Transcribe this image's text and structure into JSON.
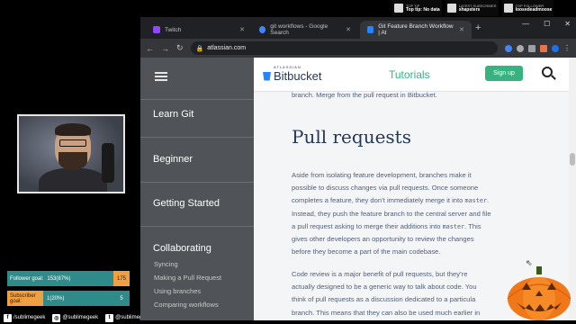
{
  "overlay": {
    "items": [
      {
        "title": "Top tip",
        "value": "Top tip: No data",
        "icon": "trophy-icon"
      },
      {
        "title": "Latest subscriber",
        "value": "shapsters",
        "icon": "star-icon"
      },
      {
        "title": "Top follower",
        "value": "loosedeadmoose",
        "icon": "heart-icon"
      }
    ]
  },
  "goals": {
    "follower": {
      "label": "Follower goal:",
      "value": "153(87%)",
      "target": "175"
    },
    "subscriber": {
      "label": "Subscriber goal:",
      "value": "1(20%)",
      "target": "5"
    }
  },
  "socials": [
    {
      "icon": "f",
      "handle": "/sublimegeek"
    },
    {
      "icon": "◎",
      "handle": "@sublimegeek"
    },
    {
      "icon": "t",
      "handle": "@sublimegeek"
    }
  ],
  "browser": {
    "tabs": [
      {
        "label": "Twitch",
        "color": "#9146ff"
      },
      {
        "label": "git workflows - Google Search",
        "color": "#4285f4"
      },
      {
        "label": "Git Feature Branch Workflow | At",
        "color": "#2684ff"
      }
    ],
    "new_tab": "+",
    "url": "atlassian.com",
    "window_controls": [
      "—",
      "☐",
      "✕"
    ]
  },
  "sidebar": {
    "sections": [
      "Learn Git",
      "Beginner",
      "Getting Started",
      "Collaborating"
    ],
    "subitems": [
      "Syncing",
      "Making a Pull Request",
      "Using branches",
      "Comparing workflows"
    ]
  },
  "header": {
    "logo_small": "ATLASSIAN",
    "logo_main": "Bitbucket",
    "nav": "Tutorials",
    "signup": "Sign up"
  },
  "article": {
    "clipped_line": "branch. Merge from the pull request in Bitbucket.",
    "heading": "Pull requests",
    "p1_lines": [
      "Aside from isolating feature development, branches make it",
      "possible to discuss changes via pull requests. Once someone",
      "completes a feature, they don’t immediately merge it into ",
      "Instead, they push the feature branch to the central server and file",
      "a pull request asking to merge their additions into ",
      "gives other developers an opportunity to review the changes",
      "before they become a part of the main codebase."
    ],
    "code1": "master",
    "code1_suffix": ".",
    "code2": "master",
    "code2_suffix": ". This",
    "p2_lines": [
      "Code review is a major benefit of pull requests, but they’re",
      "actually designed to be a generic way to talk about code. You",
      "think of pull requests as a discussion dedicated to a particula",
      "branch. This means that they can also be used much earlier in"
    ]
  }
}
